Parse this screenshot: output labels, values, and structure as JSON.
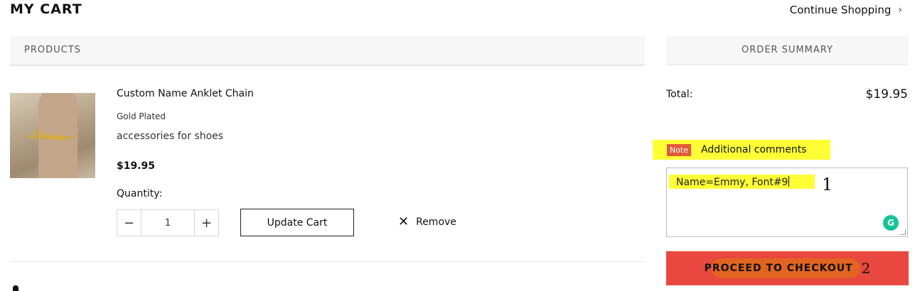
{
  "page": {
    "title": "MY CART",
    "continue_label": "Continue Shopping",
    "continue_icon": "chevron-right-icon"
  },
  "products": {
    "header": "PRODUCTS",
    "items": [
      {
        "image_icon": "anklet-photo",
        "name": "Custom Name Anklet Chain",
        "variant": "Gold Plated",
        "description": "accessories for shoes",
        "price": "$19.95",
        "quantity_label": "Quantity:",
        "quantity": "1",
        "minus": "−",
        "plus": "+",
        "update_label": "Update Cart",
        "remove_label": "Remove",
        "remove_icon": "close-icon"
      }
    ]
  },
  "summary": {
    "header": "ORDER SUMMARY",
    "total_label": "Total:",
    "total_value": "$19.95",
    "note_badge": "Note",
    "note_label": "Additional comments",
    "comment_value": "Name=Emmy, Font#9",
    "checkout_label": "PROCEED TO CHECKOUT"
  },
  "annotations": {
    "step1": "1",
    "step2": "2",
    "highlight_color": "#ffff35",
    "scribble_color": "#e16a1b"
  },
  "colors": {
    "checkout_bg": "#e8483f",
    "note_badge_bg": "#e25a3b",
    "header_bg": "#f7f7f7"
  }
}
